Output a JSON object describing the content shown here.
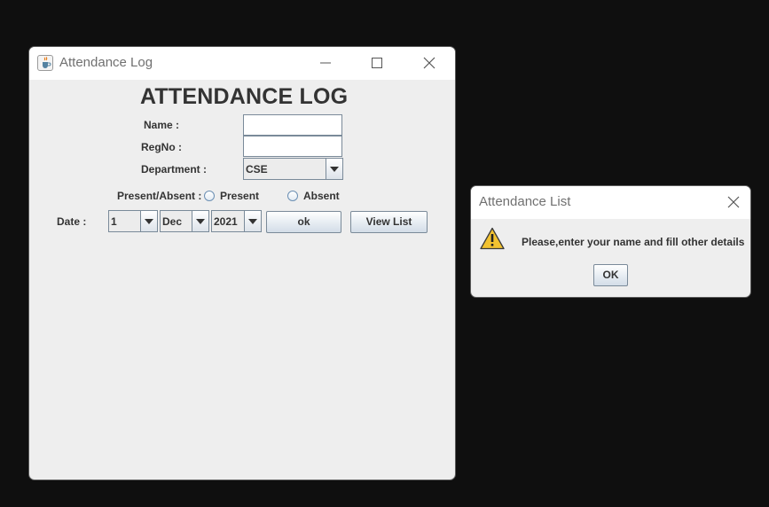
{
  "main_window": {
    "title": "Attendance Log",
    "heading": "ATTENDANCE LOG",
    "form": {
      "name_label": "Name :",
      "name_value": "",
      "regno_label": "RegNo :",
      "regno_value": "",
      "department_label": "Department :",
      "department_selected": "CSE",
      "present_absent_label": "Present/Absent :",
      "present_label": "Present",
      "absent_label": "Absent",
      "date_label": "Date :",
      "day_selected": "1",
      "month_selected": "Dec",
      "year_selected": "2021",
      "ok_button": "ok",
      "view_list_button": "View List"
    }
  },
  "dialog": {
    "title": "Attendance List",
    "message": "Please,enter your name and fill other details",
    "ok_button": "OK",
    "icon": "warning-icon"
  },
  "colors": {
    "desktop": "#0f0f0f",
    "window_body": "#eeeeee",
    "titlebar": "#ffffff",
    "text": "#333333",
    "warning": "#f2c230"
  }
}
